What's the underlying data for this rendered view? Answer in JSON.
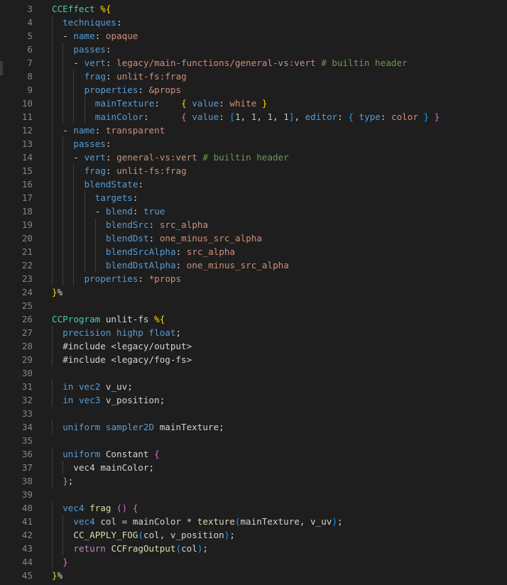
{
  "editor": {
    "language": "Cocos Effect (YAML + GLSL)",
    "lines": [
      {
        "n": "3",
        "indent": 0,
        "tokens": [
          [
            "CCEffect",
            "cls"
          ],
          [
            " ",
            "def"
          ],
          [
            "%{",
            "b1"
          ]
        ]
      },
      {
        "n": "4",
        "indent": 1,
        "tokens": [
          [
            "techniques",
            "key"
          ],
          [
            ":",
            "pun"
          ]
        ]
      },
      {
        "n": "5",
        "indent": 1,
        "tokens": [
          [
            "- ",
            "pun"
          ],
          [
            "name",
            "key"
          ],
          [
            ": ",
            "pun"
          ],
          [
            "opaque",
            "str"
          ]
        ]
      },
      {
        "n": "6",
        "indent": 2,
        "tokens": [
          [
            "passes",
            "key"
          ],
          [
            ":",
            "pun"
          ]
        ]
      },
      {
        "n": "7",
        "indent": 2,
        "tokens": [
          [
            "- ",
            "pun"
          ],
          [
            "vert",
            "key"
          ],
          [
            ": ",
            "pun"
          ],
          [
            "legacy/main-functions/general-vs:vert",
            "str"
          ],
          [
            " ",
            "def"
          ],
          [
            "# builtin header",
            "com"
          ]
        ]
      },
      {
        "n": "8",
        "indent": 3,
        "tokens": [
          [
            "frag",
            "key"
          ],
          [
            ": ",
            "pun"
          ],
          [
            "unlit-fs:frag",
            "str"
          ]
        ]
      },
      {
        "n": "9",
        "indent": 3,
        "tokens": [
          [
            "properties",
            "key"
          ],
          [
            ": ",
            "pun"
          ],
          [
            "&props",
            "str"
          ]
        ]
      },
      {
        "n": "10",
        "indent": 4,
        "tokens": [
          [
            "mainTexture",
            "key"
          ],
          [
            ":    ",
            "pun"
          ],
          [
            "{ ",
            "b1"
          ],
          [
            "value",
            "key"
          ],
          [
            ": ",
            "pun"
          ],
          [
            "white",
            "str"
          ],
          [
            " }",
            "b1"
          ]
        ]
      },
      {
        "n": "11",
        "indent": 4,
        "tokens": [
          [
            "mainColor",
            "key"
          ],
          [
            ":      ",
            "pun"
          ],
          [
            "{ ",
            "b2"
          ],
          [
            "value",
            "key"
          ],
          [
            ": ",
            "pun"
          ],
          [
            "[",
            "b3"
          ],
          [
            "1",
            "num"
          ],
          [
            ", ",
            "pun"
          ],
          [
            "1",
            "num"
          ],
          [
            ", ",
            "pun"
          ],
          [
            "1",
            "num"
          ],
          [
            ", ",
            "pun"
          ],
          [
            "1",
            "num"
          ],
          [
            "]",
            "b3"
          ],
          [
            ", ",
            "pun"
          ],
          [
            "editor",
            "key"
          ],
          [
            ": ",
            "pun"
          ],
          [
            "{ ",
            "b3"
          ],
          [
            "type",
            "key"
          ],
          [
            ": ",
            "pun"
          ],
          [
            "color",
            "str"
          ],
          [
            " }",
            "b3"
          ],
          [
            " }",
            "b2"
          ]
        ]
      },
      {
        "n": "12",
        "indent": 1,
        "tokens": [
          [
            "- ",
            "pun"
          ],
          [
            "name",
            "key"
          ],
          [
            ": ",
            "pun"
          ],
          [
            "transparent",
            "str"
          ]
        ]
      },
      {
        "n": "13",
        "indent": 2,
        "tokens": [
          [
            "passes",
            "key"
          ],
          [
            ":",
            "pun"
          ]
        ]
      },
      {
        "n": "14",
        "indent": 2,
        "tokens": [
          [
            "- ",
            "pun"
          ],
          [
            "vert",
            "key"
          ],
          [
            ": ",
            "pun"
          ],
          [
            "general-vs:vert",
            "str"
          ],
          [
            " ",
            "def"
          ],
          [
            "# builtin header",
            "com"
          ]
        ]
      },
      {
        "n": "15",
        "indent": 3,
        "tokens": [
          [
            "frag",
            "key"
          ],
          [
            ": ",
            "pun"
          ],
          [
            "unlit-fs:frag",
            "str"
          ]
        ]
      },
      {
        "n": "16",
        "indent": 3,
        "tokens": [
          [
            "blendState",
            "key"
          ],
          [
            ":",
            "pun"
          ]
        ]
      },
      {
        "n": "17",
        "indent": 4,
        "tokens": [
          [
            "targets",
            "key"
          ],
          [
            ":",
            "pun"
          ]
        ]
      },
      {
        "n": "18",
        "indent": 4,
        "tokens": [
          [
            "- ",
            "pun"
          ],
          [
            "blend",
            "key"
          ],
          [
            ": ",
            "pun"
          ],
          [
            "true",
            "key"
          ]
        ]
      },
      {
        "n": "19",
        "indent": 5,
        "tokens": [
          [
            "blendSrc",
            "key"
          ],
          [
            ": ",
            "pun"
          ],
          [
            "src_alpha",
            "str"
          ]
        ]
      },
      {
        "n": "20",
        "indent": 5,
        "tokens": [
          [
            "blendDst",
            "key"
          ],
          [
            ": ",
            "pun"
          ],
          [
            "one_minus_src_alpha",
            "str"
          ]
        ]
      },
      {
        "n": "21",
        "indent": 5,
        "tokens": [
          [
            "blendSrcAlpha",
            "key"
          ],
          [
            ": ",
            "pun"
          ],
          [
            "src_alpha",
            "str"
          ]
        ]
      },
      {
        "n": "22",
        "indent": 5,
        "tokens": [
          [
            "blendDstAlpha",
            "key"
          ],
          [
            ": ",
            "pun"
          ],
          [
            "one_minus_src_alpha",
            "str"
          ]
        ]
      },
      {
        "n": "23",
        "indent": 3,
        "tokens": [
          [
            "properties",
            "key"
          ],
          [
            ": ",
            "pun"
          ],
          [
            "*props",
            "str"
          ]
        ]
      },
      {
        "n": "24",
        "indent": 0,
        "tokens": [
          [
            "}",
            "b1"
          ],
          [
            "%",
            "def"
          ]
        ]
      },
      {
        "n": "25",
        "indent": 0,
        "tokens": []
      },
      {
        "n": "26",
        "indent": 0,
        "tokens": [
          [
            "CCProgram",
            "cls"
          ],
          [
            " ",
            "def"
          ],
          [
            "unlit-fs",
            "def"
          ],
          [
            " ",
            "def"
          ],
          [
            "%{",
            "b1"
          ]
        ]
      },
      {
        "n": "27",
        "indent": 1,
        "tokens": [
          [
            "precision",
            "kw2"
          ],
          [
            " ",
            "def"
          ],
          [
            "highp",
            "kw2"
          ],
          [
            " ",
            "def"
          ],
          [
            "float",
            "kw2"
          ],
          [
            ";",
            "pun"
          ]
        ]
      },
      {
        "n": "28",
        "indent": 1,
        "tokens": [
          [
            "#include <legacy/output>",
            "def"
          ]
        ]
      },
      {
        "n": "29",
        "indent": 1,
        "tokens": [
          [
            "#include <legacy/fog-fs>",
            "def"
          ]
        ]
      },
      {
        "n": "30",
        "indent": 0,
        "tokens": []
      },
      {
        "n": "31",
        "indent": 1,
        "tokens": [
          [
            "in",
            "kw2"
          ],
          [
            " ",
            "def"
          ],
          [
            "vec2",
            "kw2"
          ],
          [
            " v_uv;",
            "def"
          ]
        ]
      },
      {
        "n": "32",
        "indent": 1,
        "tokens": [
          [
            "in",
            "kw2"
          ],
          [
            " ",
            "def"
          ],
          [
            "vec3",
            "kw2"
          ],
          [
            " v_position;",
            "def"
          ]
        ]
      },
      {
        "n": "33",
        "indent": 0,
        "tokens": []
      },
      {
        "n": "34",
        "indent": 1,
        "tokens": [
          [
            "uniform",
            "kw2"
          ],
          [
            " ",
            "def"
          ],
          [
            "sampler2D",
            "kw2"
          ],
          [
            " mainTexture;",
            "def"
          ]
        ]
      },
      {
        "n": "35",
        "indent": 0,
        "tokens": []
      },
      {
        "n": "36",
        "indent": 1,
        "tokens": [
          [
            "uniform",
            "kw2"
          ],
          [
            " Constant ",
            "def"
          ],
          [
            "{",
            "b2"
          ]
        ]
      },
      {
        "n": "37",
        "indent": 2,
        "tokens": [
          [
            "vec4",
            "def"
          ],
          [
            " mainColor;",
            "def"
          ]
        ]
      },
      {
        "n": "38",
        "indent": 1,
        "tokens": [
          [
            "}",
            "b2"
          ],
          [
            ";",
            "pun"
          ]
        ]
      },
      {
        "n": "39",
        "indent": 0,
        "tokens": []
      },
      {
        "n": "40",
        "indent": 1,
        "tokens": [
          [
            "vec4",
            "kw2"
          ],
          [
            " ",
            "def"
          ],
          [
            "frag",
            "fn"
          ],
          [
            " ",
            "def"
          ],
          [
            "()",
            "b2"
          ],
          [
            " ",
            "def"
          ],
          [
            "{",
            "b2"
          ]
        ]
      },
      {
        "n": "41",
        "indent": 2,
        "tokens": [
          [
            "vec4",
            "kw2"
          ],
          [
            " col = mainColor * ",
            "def"
          ],
          [
            "texture",
            "fn"
          ],
          [
            "(",
            "b3"
          ],
          [
            "mainTexture, v_uv",
            "def"
          ],
          [
            ")",
            "b3"
          ],
          [
            ";",
            "pun"
          ]
        ]
      },
      {
        "n": "42",
        "indent": 2,
        "tokens": [
          [
            "CC_APPLY_FOG",
            "fn"
          ],
          [
            "(",
            "b3"
          ],
          [
            "col, v_position",
            "def"
          ],
          [
            ")",
            "b3"
          ],
          [
            ";",
            "pun"
          ]
        ]
      },
      {
        "n": "43",
        "indent": 2,
        "tokens": [
          [
            "return",
            "kw"
          ],
          [
            " ",
            "def"
          ],
          [
            "CCFragOutput",
            "fn"
          ],
          [
            "(",
            "b3"
          ],
          [
            "col",
            "def"
          ],
          [
            ")",
            "b3"
          ],
          [
            ";",
            "pun"
          ]
        ]
      },
      {
        "n": "44",
        "indent": 1,
        "tokens": [
          [
            "}",
            "b2"
          ]
        ]
      },
      {
        "n": "45",
        "indent": 0,
        "tokens": [
          [
            "}",
            "b1"
          ],
          [
            "%",
            "def"
          ]
        ]
      }
    ]
  }
}
